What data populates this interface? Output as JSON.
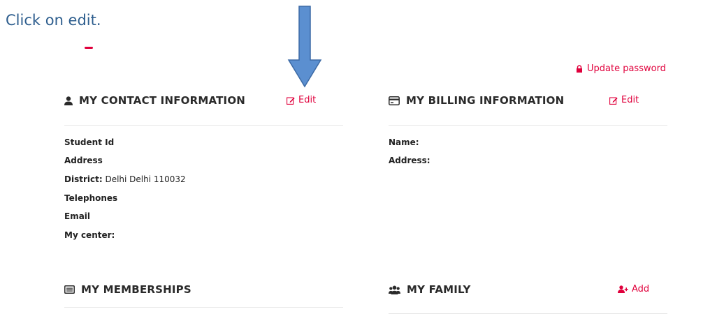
{
  "instruction": "Click on edit.",
  "update_password": "Update password",
  "contact": {
    "title": "MY CONTACT INFORMATION",
    "edit_label": "Edit",
    "fields": [
      {
        "label": "Student Id",
        "value": ""
      },
      {
        "label": "Address",
        "value": ""
      },
      {
        "label": "District:",
        "value": " Delhi Delhi 110032"
      },
      {
        "label": "Telephones",
        "value": ""
      },
      {
        "label": "Email",
        "value": ""
      },
      {
        "label": "My center:",
        "value": ""
      }
    ]
  },
  "billing": {
    "title": "MY BILLING INFORMATION",
    "edit_label": "Edit",
    "fields": [
      {
        "label": "Name:"
      },
      {
        "label": "Address:"
      }
    ]
  },
  "memberships": {
    "title": "MY MEMBERSHIPS"
  },
  "family": {
    "title": "MY FAMILY",
    "add_label": "Add"
  },
  "colors": {
    "accent": "#e0003c",
    "arrow_fill": "#5b8fd0",
    "arrow_stroke": "#3c6aa5"
  }
}
